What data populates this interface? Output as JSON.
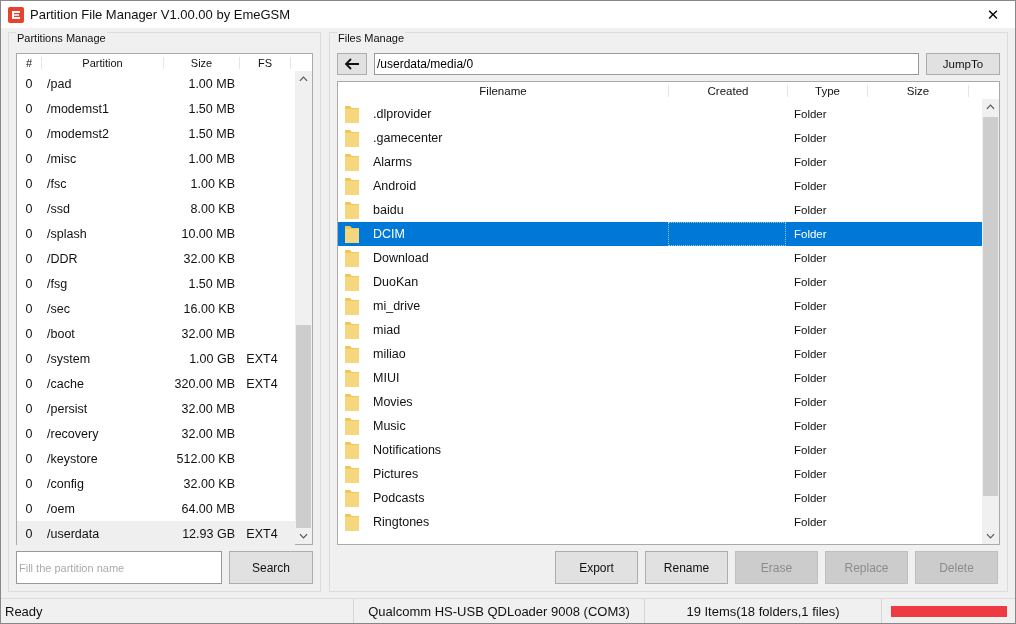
{
  "window": {
    "title": "Partition File Manager V1.00.00 by EmeGSM",
    "close": "✕"
  },
  "partitions": {
    "title": "Partitions Manage",
    "columns": [
      "#",
      "Partition",
      "Size",
      "FS"
    ],
    "rows": [
      {
        "num": "0",
        "name": "/pad",
        "size": "1.00 MB",
        "selected": false
      },
      {
        "num": "0",
        "name": "/modemst1",
        "size": "1.50 MB",
        "selected": false
      },
      {
        "num": "0",
        "name": "/modemst2",
        "size": "1.50 MB",
        "selected": false
      },
      {
        "num": "0",
        "name": "/misc",
        "size": "1.00 MB",
        "selected": false
      },
      {
        "num": "0",
        "name": "/fsc",
        "size": "1.00 KB",
        "selected": false
      },
      {
        "num": "0",
        "name": "/ssd",
        "size": "8.00 KB",
        "selected": false
      },
      {
        "num": "0",
        "name": "/splash",
        "size": "10.00 MB",
        "selected": false
      },
      {
        "num": "0",
        "name": "/DDR",
        "size": "32.00 KB",
        "selected": false
      },
      {
        "num": "0",
        "name": "/fsg",
        "size": "1.50 MB",
        "selected": false
      },
      {
        "num": "0",
        "name": "/sec",
        "size": "16.00 KB",
        "selected": false
      },
      {
        "num": "0",
        "name": "/boot",
        "size": "32.00 MB",
        "selected": false
      },
      {
        "num": "0",
        "name": "/system",
        "size": "1.00 GB",
        "fs": "EXT4",
        "selected": false
      },
      {
        "num": "0",
        "name": "/cache",
        "size": "320.00 MB",
        "fs": "EXT4",
        "selected": false
      },
      {
        "num": "0",
        "name": "/persist",
        "size": "32.00 MB",
        "selected": false
      },
      {
        "num": "0",
        "name": "/recovery",
        "size": "32.00 MB",
        "selected": false
      },
      {
        "num": "0",
        "name": "/keystore",
        "size": "512.00 KB",
        "selected": false
      },
      {
        "num": "0",
        "name": "/config",
        "size": "32.00 KB",
        "selected": false
      },
      {
        "num": "0",
        "name": "/oem",
        "size": "64.00 MB",
        "selected": false
      },
      {
        "num": "0",
        "name": "/userdata",
        "size": "12.93 GB",
        "fs": "EXT4",
        "selected": true
      }
    ],
    "search": {
      "placeholder": "Fill the partition name"
    },
    "search_button": "Search"
  },
  "files": {
    "title": "Files Manage",
    "path": "/userdata/media/0",
    "jump_button": "JumpTo",
    "columns": [
      "Filename",
      "Created",
      "Type",
      "Size"
    ],
    "rows": [
      {
        "name": ".dlprovider",
        "type": "Folder",
        "selected": false
      },
      {
        "name": ".gamecenter",
        "type": "Folder",
        "selected": false
      },
      {
        "name": "Alarms",
        "type": "Folder",
        "selected": false
      },
      {
        "name": "Android",
        "type": "Folder",
        "selected": false
      },
      {
        "name": "baidu",
        "type": "Folder",
        "selected": false
      },
      {
        "name": "DCIM",
        "type": "Folder",
        "selected": true
      },
      {
        "name": "Download",
        "type": "Folder",
        "selected": false
      },
      {
        "name": "DuoKan",
        "type": "Folder",
        "selected": false
      },
      {
        "name": "mi_drive",
        "type": "Folder",
        "selected": false
      },
      {
        "name": "miad",
        "type": "Folder",
        "selected": false
      },
      {
        "name": "miliao",
        "type": "Folder",
        "selected": false
      },
      {
        "name": "MIUI",
        "type": "Folder",
        "selected": false
      },
      {
        "name": "Movies",
        "type": "Folder",
        "selected": false
      },
      {
        "name": "Music",
        "type": "Folder",
        "selected": false
      },
      {
        "name": "Notifications",
        "type": "Folder",
        "selected": false
      },
      {
        "name": "Pictures",
        "type": "Folder",
        "selected": false
      },
      {
        "name": "Podcasts",
        "type": "Folder",
        "selected": false
      },
      {
        "name": "Ringtones",
        "type": "Folder",
        "selected": false
      }
    ],
    "buttons": [
      {
        "label": "Export",
        "disabled": false
      },
      {
        "label": "Rename",
        "disabled": false
      },
      {
        "label": "Erase",
        "disabled": true
      },
      {
        "label": "Replace",
        "disabled": true
      },
      {
        "label": "Delete",
        "disabled": true
      }
    ]
  },
  "status_bar": {
    "status": "Ready",
    "device": "Qualcomm HS-USB QDLoader 9008 (COM3)",
    "items": "19 Items(18 folders,1 files)",
    "progress": {
      "level": 1
    }
  }
}
